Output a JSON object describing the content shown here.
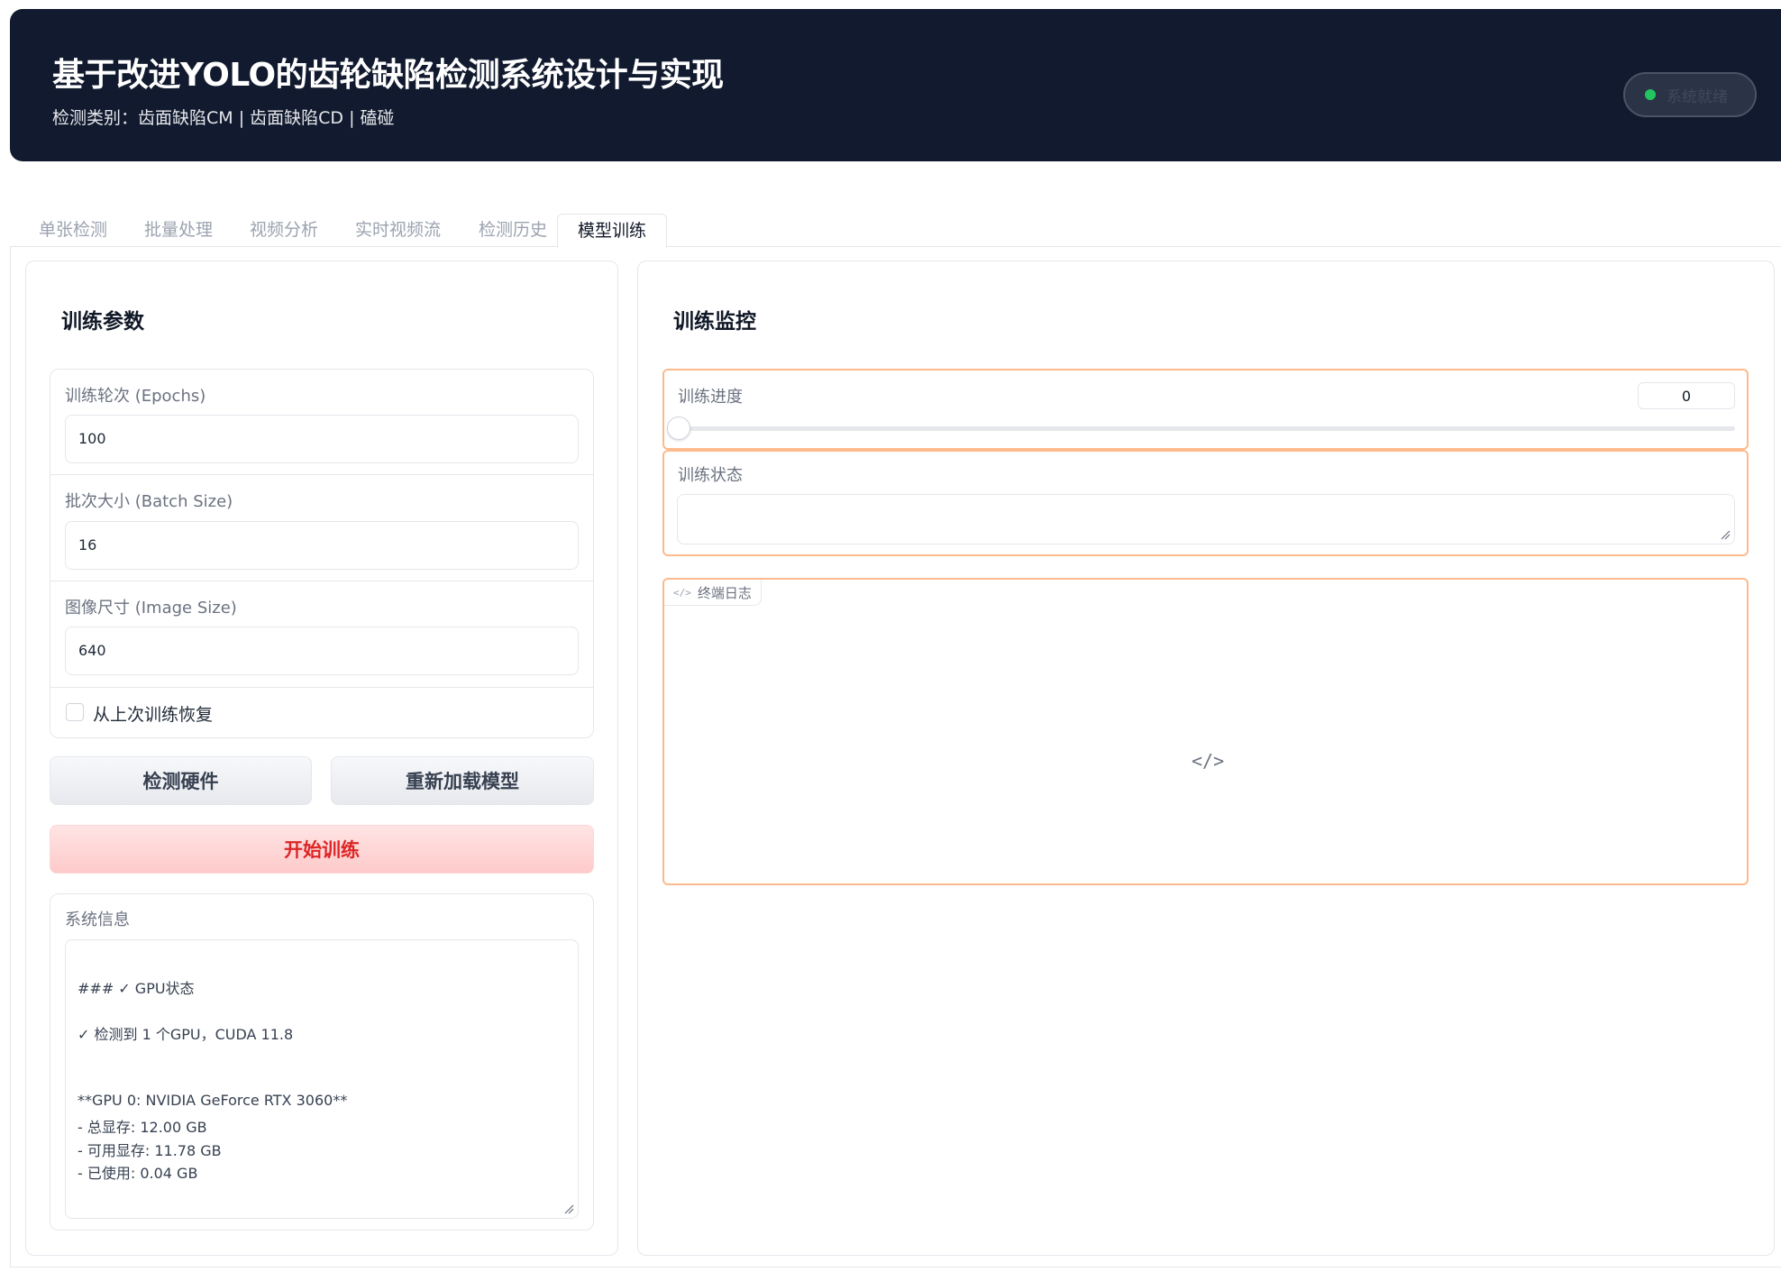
{
  "header": {
    "title": "基于改进YOLO的齿轮缺陷检测系统设计与实现",
    "subtitle": "检测类别：齿面缺陷CM | 齿面缺陷CD | 磕碰",
    "status_text": "系统就绪",
    "status_color": "#22c55e"
  },
  "tabs": [
    "单张检测",
    "批量处理",
    "视频分析",
    "实时视频流",
    "检测历史",
    "模型训练"
  ],
  "active_tab": "模型训练",
  "training_params": {
    "title": "训练参数",
    "epochs": {
      "label": "训练轮次 (Epochs)",
      "value": "100"
    },
    "batch_size": {
      "label": "批次大小 (Batch Size)",
      "value": "16"
    },
    "image_size": {
      "label": "图像尺寸 (Image Size)",
      "value": "640"
    },
    "resume": {
      "label": "从上次训练恢复",
      "checked": false
    },
    "detect_hw_button": "检测硬件",
    "reload_model_button": "重新加载模型",
    "start_button": "开始训练",
    "sysinfo": {
      "label": "系统信息",
      "lines": [
        "### ✓ GPU状态",
        "✓ 检测到 1 个GPU，CUDA 11.8",
        "**GPU 0: NVIDIA GeForce RTX 3060**",
        "- 总显存: 12.00 GB",
        "- 可用显存: 11.78 GB",
        "- 已使用: 0.04 GB"
      ]
    }
  },
  "monitor": {
    "title": "训练监控",
    "progress": {
      "label": "训练进度",
      "value": "0",
      "fraction": 0
    },
    "status": {
      "label": "训练状态",
      "value": ""
    },
    "log": {
      "label": "终端日志",
      "placeholder_icon": "code-icon"
    },
    "accent_color": "#fdba8c"
  }
}
